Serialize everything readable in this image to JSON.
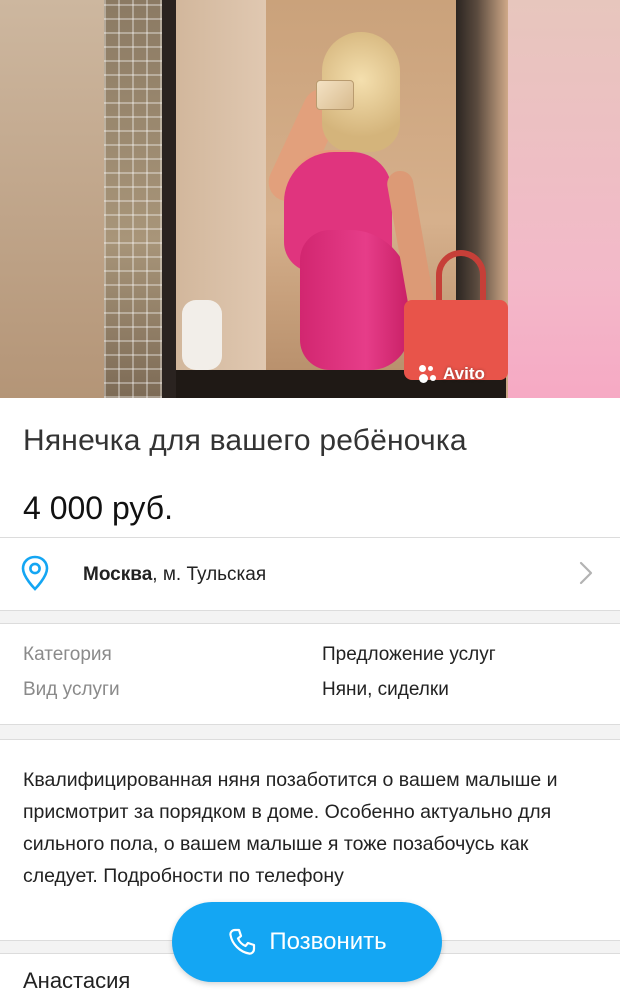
{
  "photo": {
    "watermark": "Avito",
    "watermark_icon": "avito-dots-logo"
  },
  "listing": {
    "title": "Нянечка для вашего ребёночка",
    "price": "4 000 руб."
  },
  "location": {
    "city": "Москва",
    "metro": ", м. Тульская",
    "icon": "location-pin-icon",
    "chevron": "chevron-right-icon",
    "accent_color": "#14a6f3"
  },
  "params": [
    {
      "key": "Категория",
      "value": "Предложение услуг"
    },
    {
      "key": "Вид услуги",
      "value": "Няни, сиделки"
    }
  ],
  "description": "Квалифицированная няня позаботится о вашем малыше и присмотрит за порядком в доме. Особенно актуально для сильного пола, о вашем малыше я тоже позабочусь как следует. Подробности по телефону",
  "seller": {
    "name": "Анастасия"
  },
  "call_button": {
    "label": "Позвонить",
    "icon": "phone-icon",
    "color": "#14a6f3"
  }
}
